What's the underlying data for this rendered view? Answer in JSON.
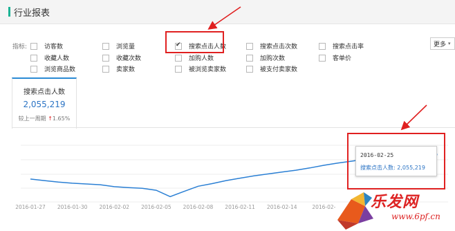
{
  "header": {
    "title": "行业报表"
  },
  "indicators": {
    "label": "指标:",
    "items": [
      {
        "label": "访客数",
        "checked": false
      },
      {
        "label": "浏览量",
        "checked": false
      },
      {
        "label": "搜索点击人数",
        "checked": true
      },
      {
        "label": "搜索点击次数",
        "checked": false
      },
      {
        "label": "搜索点击率",
        "checked": false
      },
      {
        "label": "收藏人数",
        "checked": false
      },
      {
        "label": "收藏次数",
        "checked": false
      },
      {
        "label": "加购人数",
        "checked": false
      },
      {
        "label": "加购次数",
        "checked": false
      },
      {
        "label": "客单价",
        "checked": false
      },
      {
        "label": "浏览商品数",
        "checked": false
      },
      {
        "label": "卖家数",
        "checked": false
      },
      {
        "label": "被浏览卖家数",
        "checked": false
      },
      {
        "label": "被支付卖家数",
        "checked": false
      }
    ],
    "more_label": "更多"
  },
  "metric_tab": {
    "title": "搜索点击人数",
    "value": "2,055,219",
    "compare_prefix": "较上一周期",
    "compare_arrow": "↑",
    "compare_value": "1.65%"
  },
  "tooltip": {
    "date": "2016-02-25",
    "label": "搜索点击人数:",
    "value": "2,055,219"
  },
  "watermark": {
    "brand": "乐发网",
    "url": "www.6pf.cn"
  },
  "colors": {
    "accent": "#2a8ad4",
    "line": "#2a7fd4",
    "annotation": "#e02020",
    "header_bar": "#1ab394"
  },
  "chart_data": {
    "type": "line",
    "x": [
      "2016-01-27",
      "2016-01-28",
      "2016-01-29",
      "2016-01-30",
      "2016-01-31",
      "2016-02-01",
      "2016-02-02",
      "2016-02-03",
      "2016-02-04",
      "2016-02-05",
      "2016-02-06",
      "2016-02-07",
      "2016-02-08",
      "2016-02-09",
      "2016-02-10",
      "2016-02-11",
      "2016-02-12",
      "2016-02-13",
      "2016-02-14",
      "2016-02-15",
      "2016-02-16",
      "2016-02-17",
      "2016-02-18",
      "2016-02-19",
      "2016-02-20",
      "2016-02-21",
      "2016-02-22",
      "2016-02-23",
      "2016-02-24",
      "2016-02-25"
    ],
    "x_tick_labels": [
      "2016-01-27",
      "2016-01-30",
      "2016-02-02",
      "2016-02-05",
      "2016-02-08",
      "2016-02-11",
      "2016-02-14",
      "2016-02-"
    ],
    "series": [
      {
        "values": [
          1405000,
          1365000,
          1325000,
          1295000,
          1275000,
          1255000,
          1205000,
          1180000,
          1160000,
          1110000,
          940000,
          1080000,
          1215000,
          1285000,
          1365000,
          1430000,
          1490000,
          1540000,
          1590000,
          1640000,
          1700000,
          1770000,
          1830000,
          1880000,
          1935000,
          1975000,
          2005000,
          2030000,
          2045000,
          2055219
        ]
      }
    ],
    "ylim": [
      800000,
      2300000
    ],
    "grid": true,
    "highlight_index": 29
  }
}
